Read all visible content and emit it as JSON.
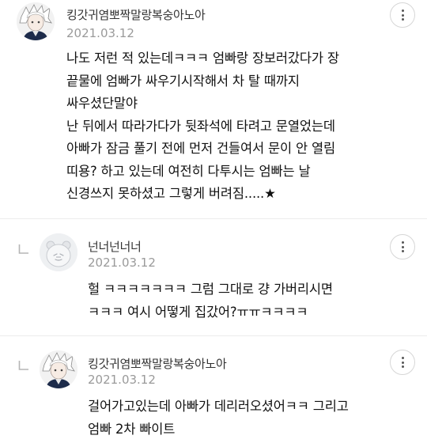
{
  "comments": [
    {
      "author": "킹갓귀염뽀짝말랑복숭아노아",
      "date": "2021.03.12",
      "avatar_icon": "anime-character-avatar",
      "lines": [
        "나도 저런 적 있는데ㅋㅋㅋ 엄빠랑 장보러갔다가 장",
        "끝물에 엄빠가 싸우기시작해서 차 탈 때까지",
        "싸우셨단말야",
        "난 뒤에서 따라가다가 뒷좌석에 타려고 문열었는데",
        "아빠가 잠금 풀기 전에 먼저 건들여서 문이 안 열림",
        "띠용? 하고 있는데 여전히 다투시는 엄빠는 날",
        "신경쓰지 못하셨고 그렇게 버려짐.....★"
      ]
    },
    {
      "author": "넌너넌너너",
      "date": "2021.03.12",
      "avatar_icon": "default-profile-avatar",
      "is_reply": true,
      "lines": [
        "헐 ㅋㅋㅋㅋㅋㅋㅋ 그럼 그대로 걍 가버리시면",
        "ㅋㅋㅋ 여시 어떻게 집갔어?ㅠㅠㅋㅋㅋㅋ"
      ]
    },
    {
      "author": "킹갓귀염뽀짝말랑복숭아노아",
      "date": "2021.03.12",
      "avatar_icon": "anime-character-avatar",
      "is_reply": true,
      "lines": [
        "걸어가고있는데 아빠가 데리러오셨어ㅋㅋ 그리고",
        "엄빠 2차 빠이트"
      ]
    }
  ],
  "colors": {
    "text": "#111111",
    "meta": "#9a9a9a",
    "divider": "#ececec"
  }
}
